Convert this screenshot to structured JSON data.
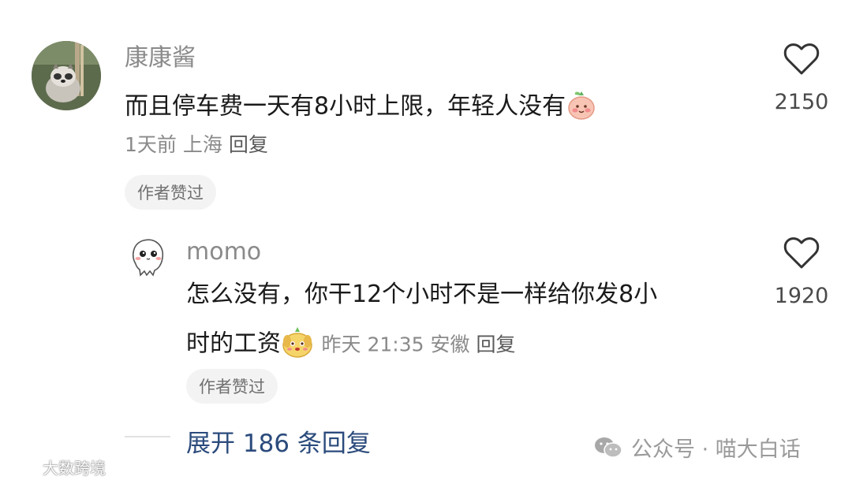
{
  "comments": [
    {
      "username": "康康酱",
      "text": "而且停车费一天有8小时上限，年轻人没有",
      "emoji": "peach-blush-emoji",
      "meta": {
        "time": "1天前",
        "location": "上海",
        "reply": "回复"
      },
      "badge": "作者赞过",
      "likes": "2150",
      "avatar": "raccoon-photo"
    }
  ],
  "reply": {
    "username": "momo",
    "text_line1": "怎么没有，你干12个小时不是一样给你发8小",
    "text_line2": "时的工资",
    "emoji": "puppy-emoji",
    "meta": {
      "time": "昨天 21:35",
      "location": "安徽",
      "reply": "回复"
    },
    "badge": "作者赞过",
    "likes": "1920",
    "avatar": "cartoon-blob"
  },
  "expand": {
    "label": "展开 186 条回复"
  },
  "watermark_right": "公众号 · 喵大白话",
  "watermark_left": "大数跨境",
  "colors": {
    "link": "#2b4b7c",
    "meta": "#8a8a8a",
    "badge_bg": "#f3f3f3"
  }
}
